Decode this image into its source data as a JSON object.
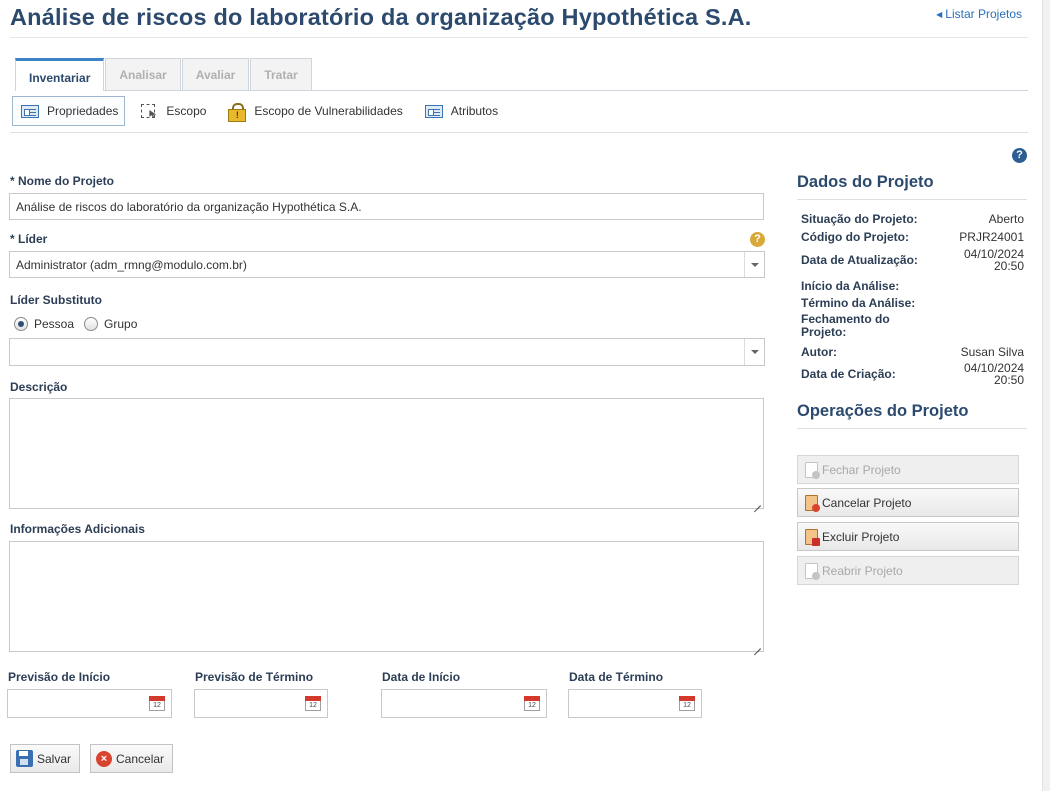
{
  "header": {
    "title": "Análise de riscos do laboratório da organização Hypothética S.A.",
    "back_link": "Listar Projetos"
  },
  "tabs": [
    {
      "label": "Inventariar",
      "active": true
    },
    {
      "label": "Analisar",
      "active": false
    },
    {
      "label": "Avaliar",
      "active": false
    },
    {
      "label": "Tratar",
      "active": false
    }
  ],
  "subnav": [
    {
      "label": "Propriedades",
      "icon": "form-icon",
      "active": true
    },
    {
      "label": "Escopo",
      "icon": "scope-icon",
      "active": false
    },
    {
      "label": "Escopo de Vulnerabilidades",
      "icon": "vulnerability-lock-icon",
      "active": false
    },
    {
      "label": "Atributos",
      "icon": "form-icon",
      "active": false
    }
  ],
  "form": {
    "project_name_label": "* Nome do Projeto",
    "project_name_value": "Análise de riscos do laboratório da organização Hypothética S.A.",
    "leader_label": "* Líder",
    "leader_value": "Administrator (adm_rmng@modulo.com.br)",
    "substitute_label": "Líder Substituto",
    "radio_person": "Pessoa",
    "radio_group": "Grupo",
    "radio_selected": "Pessoa",
    "substitute_value": "",
    "description_label": "Descrição",
    "description_value": "",
    "additional_label": "Informações Adicionais",
    "additional_value": "",
    "dates": [
      {
        "label": "Previsão de Início",
        "value": ""
      },
      {
        "label": "Previsão de Término",
        "value": ""
      },
      {
        "label": "Data de Início",
        "value": ""
      },
      {
        "label": "Data de Término",
        "value": ""
      }
    ],
    "save_label": "Salvar",
    "cancel_label": "Cancelar"
  },
  "project_data": {
    "title": "Dados do Projeto",
    "rows": [
      {
        "label": "Situação do Projeto:",
        "value": "Aberto"
      },
      {
        "label": "Código do Projeto:",
        "value": "PRJR24001"
      },
      {
        "label": "Data de Atualização:",
        "value": "04/10/2024 20:50"
      },
      {
        "label": "Início da Análise:",
        "value": ""
      },
      {
        "label": "Término da Análise:",
        "value": ""
      },
      {
        "label": "Fechamento do Projeto:",
        "value": ""
      },
      {
        "label": "Autor:",
        "value": "Susan Silva"
      },
      {
        "label": "Data de Criação:",
        "value": "04/10/2024 20:50"
      }
    ]
  },
  "operations": {
    "title": "Operações do Projeto",
    "buttons": [
      {
        "label": "Fechar Projeto",
        "enabled": false
      },
      {
        "label": "Cancelar Projeto",
        "enabled": true
      },
      {
        "label": "Excluir Projeto",
        "enabled": true
      },
      {
        "label": "Reabrir Projeto",
        "enabled": false
      }
    ]
  },
  "colors": {
    "title": "#2c4a6e",
    "link": "#2a6ebb",
    "active_tab_border": "#3d83c8"
  }
}
